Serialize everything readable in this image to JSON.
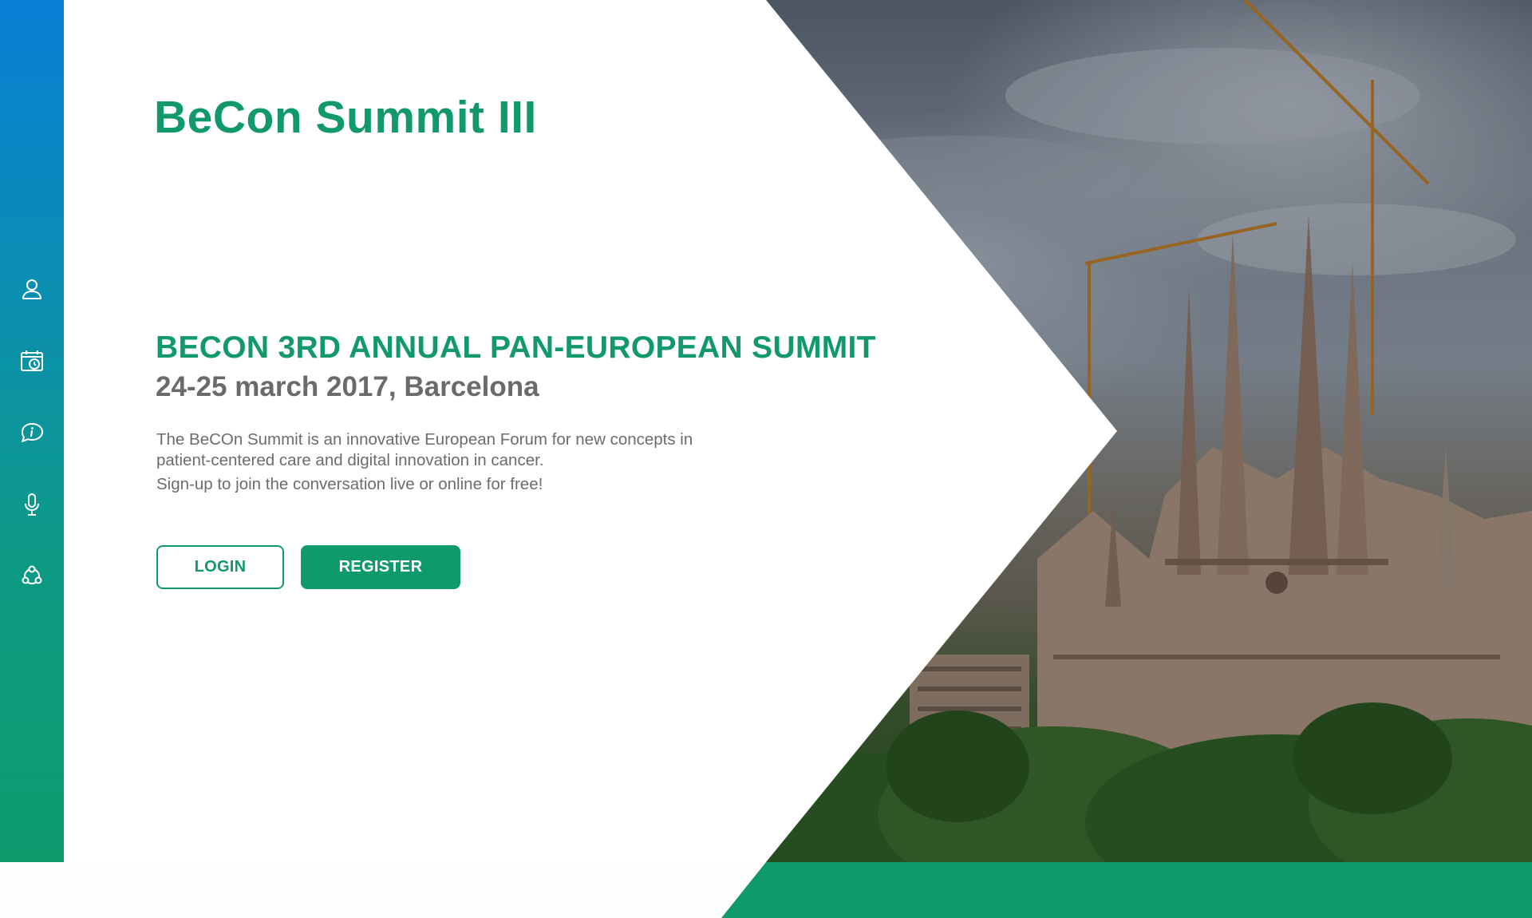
{
  "brand": {
    "title": "BeCon Summit III"
  },
  "hero": {
    "headline": "BECON 3RD ANNUAL PAN-EUROPEAN SUMMIT",
    "date_location": "24-25 march 2017, Barcelona",
    "description_line1": "The BeCOn Summit is an innovative European Forum for new concepts in",
    "description_line2": "patient-centered care and digital innovation in cancer.",
    "description_line3": "Sign-up to join the conversation live or online for free!"
  },
  "actions": {
    "login_label": "LOGIN",
    "register_label": "REGISTER"
  },
  "sidebar": {
    "items": [
      {
        "icon": "user-icon"
      },
      {
        "icon": "calendar-clock-icon"
      },
      {
        "icon": "info-chat-icon"
      },
      {
        "icon": "microphone-icon"
      },
      {
        "icon": "network-icon"
      }
    ]
  },
  "colors": {
    "brand_green": "#12996b",
    "sidebar_top": "#0a7fd6",
    "sidebar_bottom": "#0e9a6c",
    "text_gray": "#6a6a6a"
  }
}
